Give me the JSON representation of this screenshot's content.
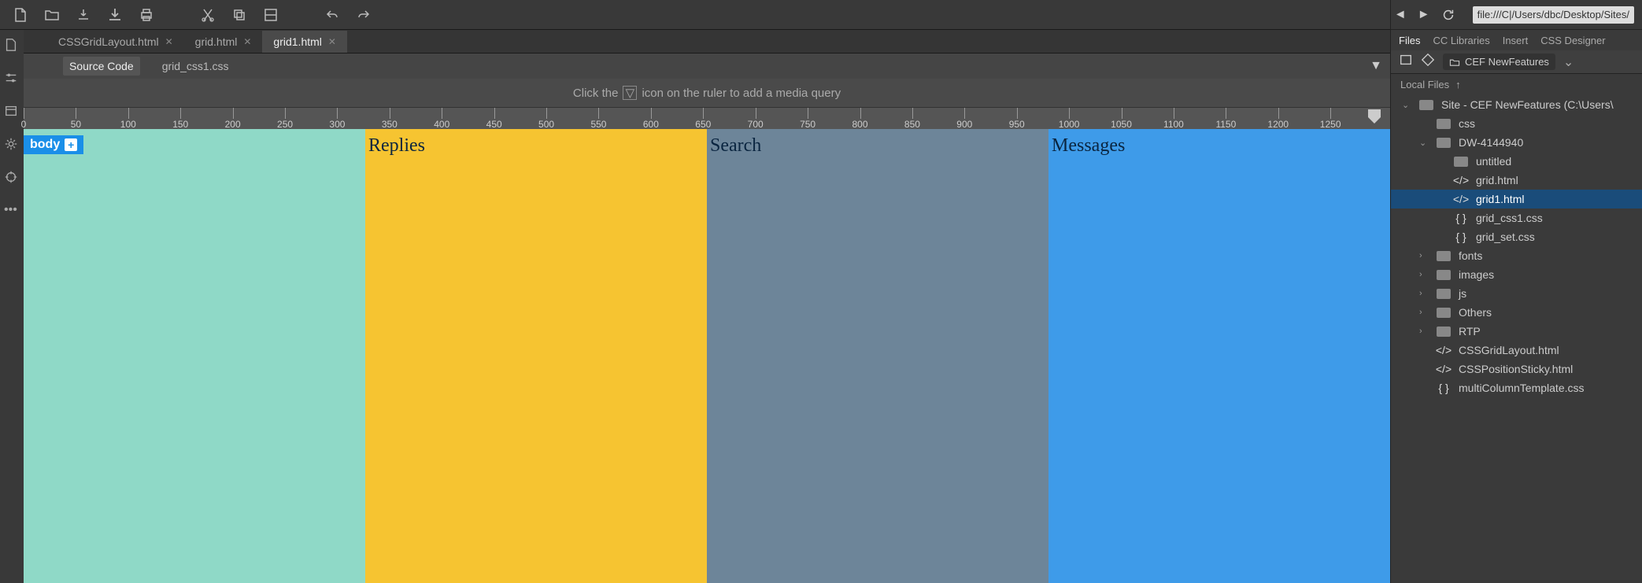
{
  "toolbar": {
    "icons": [
      "new-file",
      "open",
      "cloud-down",
      "download",
      "print",
      "cut",
      "copy",
      "collapse",
      "undo",
      "redo"
    ]
  },
  "nav": {
    "url": "file:///C|/Users/dbc/Desktop/Sites/"
  },
  "doc_tabs": [
    {
      "label": "CSSGridLayout.html",
      "active": false
    },
    {
      "label": "grid.html",
      "active": false
    },
    {
      "label": "grid1.html",
      "active": true
    }
  ],
  "sub_tabs": [
    {
      "label": "Source Code",
      "active": true
    },
    {
      "label": "grid_css1.css",
      "active": false
    }
  ],
  "hint": {
    "pre": "Click the",
    "post": "icon on the ruler to add a media query"
  },
  "ruler": {
    "ticks": [
      0,
      50,
      100,
      150,
      200,
      250,
      300,
      350,
      400,
      450,
      500,
      550,
      600,
      650,
      700,
      750,
      800,
      850,
      900,
      950,
      1000,
      1050,
      1100,
      1150,
      1200,
      1250
    ]
  },
  "canvas": {
    "body_tag": "body",
    "cells": [
      {
        "label": ""
      },
      {
        "label": "Replies"
      },
      {
        "label": "Search"
      },
      {
        "label": "Messages"
      }
    ]
  },
  "panels": {
    "tabs": [
      "Files",
      "CC Libraries",
      "Insert",
      "CSS Designer"
    ],
    "active_tab": "Files",
    "site_selector": "CEF NewFeatures",
    "local_label": "Local Files",
    "tree": [
      {
        "depth": 0,
        "arrow": "down",
        "type": "folder",
        "label": "Site - CEF NewFeatures (C:\\Users\\"
      },
      {
        "depth": 1,
        "arrow": "",
        "type": "folder",
        "label": "css"
      },
      {
        "depth": 1,
        "arrow": "down",
        "type": "folder",
        "label": "DW-4144940"
      },
      {
        "depth": 2,
        "arrow": "",
        "type": "folder",
        "label": "untitled"
      },
      {
        "depth": 2,
        "arrow": "",
        "type": "html",
        "label": "grid.html"
      },
      {
        "depth": 2,
        "arrow": "",
        "type": "html",
        "label": "grid1.html",
        "selected": true
      },
      {
        "depth": 2,
        "arrow": "",
        "type": "css",
        "label": "grid_css1.css"
      },
      {
        "depth": 2,
        "arrow": "",
        "type": "css",
        "label": "grid_set.css"
      },
      {
        "depth": 1,
        "arrow": "right",
        "type": "folder",
        "label": "fonts"
      },
      {
        "depth": 1,
        "arrow": "right",
        "type": "folder",
        "label": "images"
      },
      {
        "depth": 1,
        "arrow": "right",
        "type": "folder",
        "label": "js"
      },
      {
        "depth": 1,
        "arrow": "right",
        "type": "folder",
        "label": "Others"
      },
      {
        "depth": 1,
        "arrow": "right",
        "type": "folder",
        "label": "RTP"
      },
      {
        "depth": 1,
        "arrow": "",
        "type": "html",
        "label": "CSSGridLayout.html"
      },
      {
        "depth": 1,
        "arrow": "",
        "type": "html",
        "label": "CSSPositionSticky.html"
      },
      {
        "depth": 1,
        "arrow": "",
        "type": "css",
        "label": "multiColumnTemplate.css"
      }
    ]
  }
}
